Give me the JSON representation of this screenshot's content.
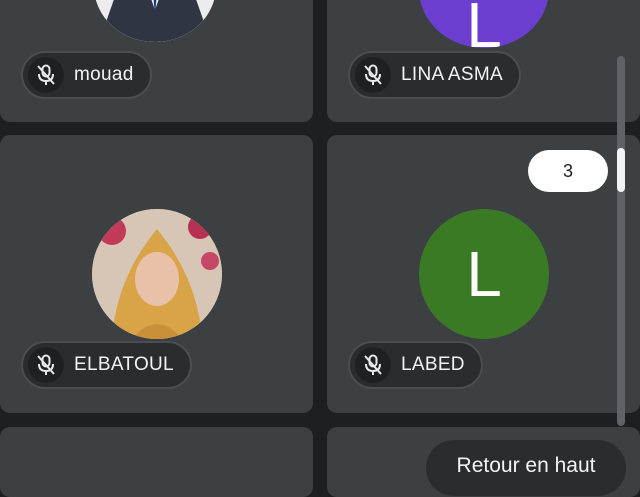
{
  "participants": [
    {
      "name": "mouad",
      "muted": true,
      "avatar": "photo-man-in-suit"
    },
    {
      "name": "LINA ASMA",
      "muted": true,
      "avatar_letter": "L",
      "avatar_color": "#6c3fd1"
    },
    {
      "name": "ELBATOUL",
      "muted": true,
      "avatar": "photo-woman-hijab"
    },
    {
      "name": "LABED",
      "muted": true,
      "avatar_letter": "L",
      "avatar_color": "#3b7a24"
    }
  ],
  "scroll": {
    "page_number": "3"
  },
  "back_to_top_label": "Retour en haut",
  "icons": {
    "mic": "mic-off-icon"
  },
  "colors": {
    "background": "#1e1f22",
    "tile": "#3c4043",
    "pill": "#2b2c30"
  }
}
